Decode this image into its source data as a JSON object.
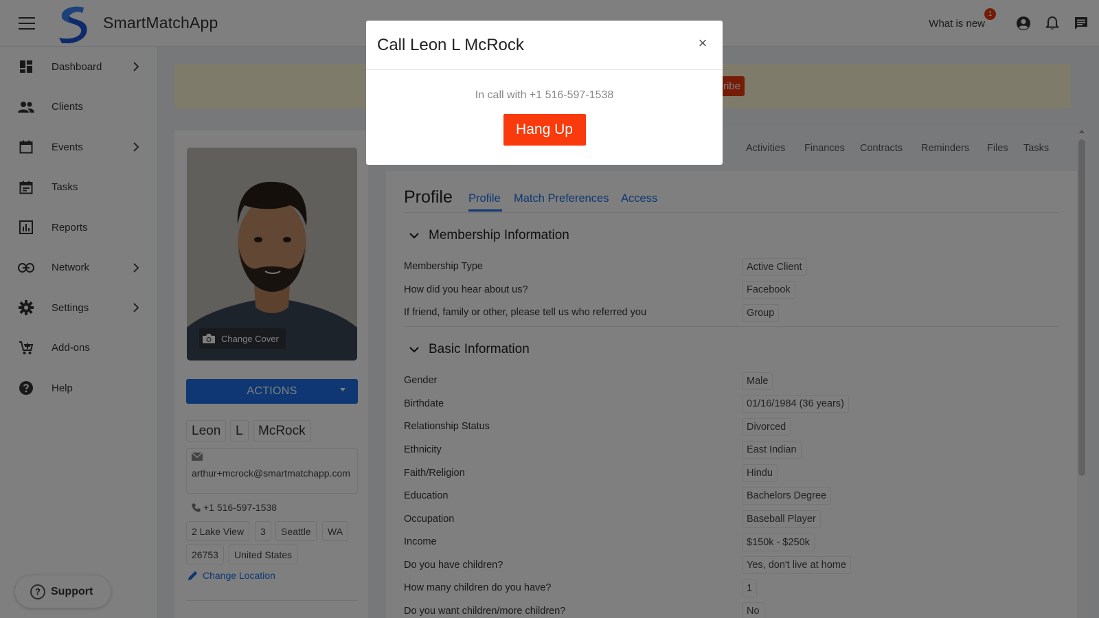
{
  "app": {
    "brand": "SmartMatchApp"
  },
  "topbar": {
    "whats_new": "What is new",
    "whats_new_count": "1"
  },
  "sidebar": {
    "items": [
      {
        "label": "Dashboard",
        "icon": "dashboard-icon",
        "has_submenu": true
      },
      {
        "label": "Clients",
        "icon": "people-icon",
        "has_submenu": false
      },
      {
        "label": "Events",
        "icon": "calendar-icon",
        "has_submenu": true
      },
      {
        "label": "Tasks",
        "icon": "tasks-calendar-icon",
        "has_submenu": false
      },
      {
        "label": "Reports",
        "icon": "bar-chart-icon",
        "has_submenu": false
      },
      {
        "label": "Network",
        "icon": "link-icon",
        "has_submenu": true
      },
      {
        "label": "Settings",
        "icon": "gear-icon",
        "has_submenu": true
      },
      {
        "label": "Add-ons",
        "icon": "cart-icon",
        "has_submenu": false
      },
      {
        "label": "Help",
        "icon": "help-icon",
        "has_submenu": false
      }
    ],
    "support_label": "Support"
  },
  "banner": {
    "button_fragment": "ribe"
  },
  "profile_card": {
    "change_cover": "Change Cover",
    "actions_label": "ACTIONS",
    "first_name": "Leon",
    "middle_initial": "L",
    "last_name": "McRock",
    "email": "arthur+mcrock@smartmatchapp.com",
    "phone": "+1 516-597-1538",
    "address": {
      "street": "2 Lake View",
      "unit": "3",
      "city": "Seattle",
      "state": "WA",
      "zip": "26753",
      "country": "United States"
    },
    "change_location": "Change Location"
  },
  "top_tabs": [
    "Activities",
    "Finances",
    "Contracts",
    "Reminders",
    "Files",
    "Tasks"
  ],
  "profile": {
    "heading": "Profile",
    "sub_tabs": [
      "Profile",
      "Match Preferences",
      "Access"
    ],
    "sections": [
      {
        "title": "Membership Information",
        "fields": [
          {
            "label": "Membership Type",
            "value": "Active Client"
          },
          {
            "label": "How did you hear about us?",
            "value": "Facebook"
          },
          {
            "label": "If friend, family or other, please tell us who referred you",
            "value": "Group"
          }
        ]
      },
      {
        "title": "Basic Information",
        "fields": [
          {
            "label": "Gender",
            "value": "Male"
          },
          {
            "label": "Birthdate",
            "value": "01/16/1984 (36 years)"
          },
          {
            "label": "Relationship Status",
            "value": "Divorced"
          },
          {
            "label": "Ethnicity",
            "value": "East Indian"
          },
          {
            "label": "Faith/Religion",
            "value": "Hindu"
          },
          {
            "label": "Education",
            "value": "Bachelors Degree"
          },
          {
            "label": "Occupation",
            "value": "Baseball Player"
          },
          {
            "label": "Income",
            "value": "$150k - $250k"
          },
          {
            "label": "Do you have children?",
            "value": "Yes, don't live at home"
          },
          {
            "label": "How many children do you have?",
            "value": "1"
          },
          {
            "label": "Do you want children/more children?",
            "value": "No"
          }
        ]
      }
    ]
  },
  "modal": {
    "title": "Call Leon L McRock",
    "close_glyph": "×",
    "status": "In call with +1 516-597-1538",
    "hangup_label": "Hang Up"
  },
  "colors": {
    "primary": "#1d6ee8",
    "danger": "#f83a0c",
    "banner": "#fff6d6"
  }
}
